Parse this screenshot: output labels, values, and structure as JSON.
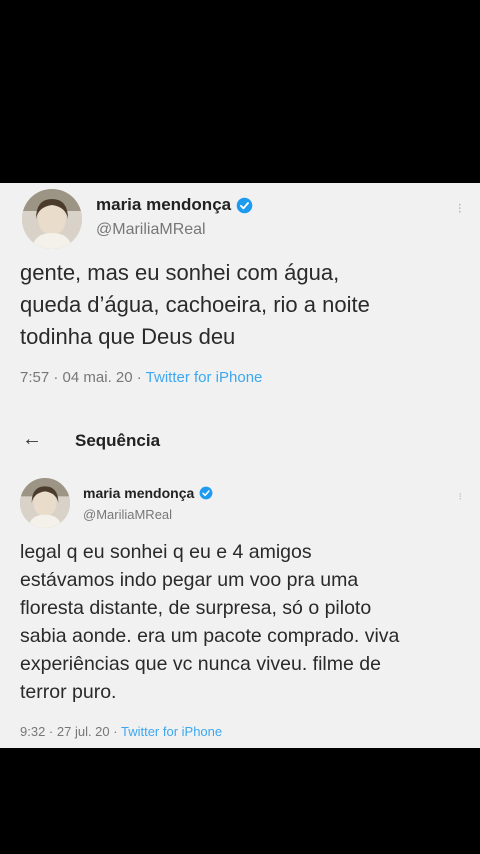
{
  "tweet": {
    "display_name": "maria mendonça",
    "handle": "@MariliaMReal",
    "text": "gente, mas eu sonhei com água,\nqueda d’água, cachoeira, rio a noite\ntodinha que Deus deu",
    "time": "7:57",
    "date": "04 mai. 20",
    "source": "Twitter for iPhone",
    "more_icon": "⁝"
  },
  "thread": {
    "back_icon": "←",
    "title": "Sequência"
  },
  "reply": {
    "display_name": "maria mendonça",
    "handle": "@MariliaMReal",
    "text": "legal q eu sonhei q eu e 4 amigos\nestávamos indo pegar um voo pra uma\nfloresta distante, de surpresa, só o piloto\nsabia aonde. era um pacote comprado. viva\nexperiências que vc nunca viveu. filme de\nterror puro.",
    "time": "9:32",
    "date": "27 jul. 20",
    "source": "Twitter for iPhone",
    "more_icon": "⁝"
  },
  "colors": {
    "accent": "#1d9bf0",
    "background": "#f1f1f1",
    "letterbox": "#000000"
  }
}
